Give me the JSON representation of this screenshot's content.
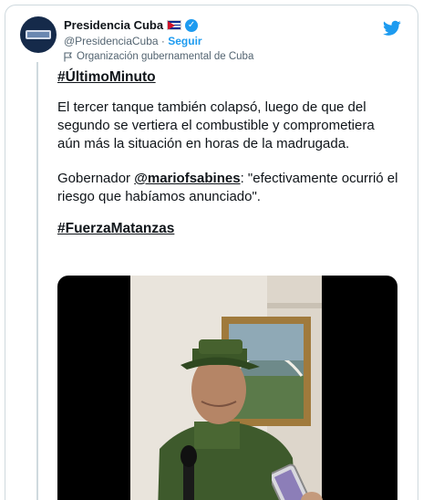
{
  "account": {
    "name": "Presidencia Cuba",
    "flag_icon": "cuba-flag-icon",
    "verified_icon": "verified-badge-icon",
    "handle": "@PresidenciaCuba",
    "separator": " · ",
    "follow_label": "Seguir",
    "org_icon": "flag-outline-icon",
    "org_label": "Organización gubernamental de Cuba"
  },
  "brand_icon": "twitter-bird-icon",
  "tweet": {
    "hashtag_top": "#ÚltimoMinuto",
    "paragraph1": "El tercer tanque también colapsó, luego de que del segundo se vertiera el combustible y comprometiera aún más la situación en horas de la madrugada.",
    "paragraph2_prefix": "Gobernador ",
    "paragraph2_mention": "@mariofsabines",
    "paragraph2_suffix": ": \"efectivamente ocurrió el riesgo que habíamos anunciado\".",
    "hashtag_bottom": "#FuerzaMatanzas"
  },
  "colors": {
    "accent": "#1d9bf0",
    "text": "#0f1419",
    "muted": "#536471",
    "border": "#cfd9de"
  }
}
